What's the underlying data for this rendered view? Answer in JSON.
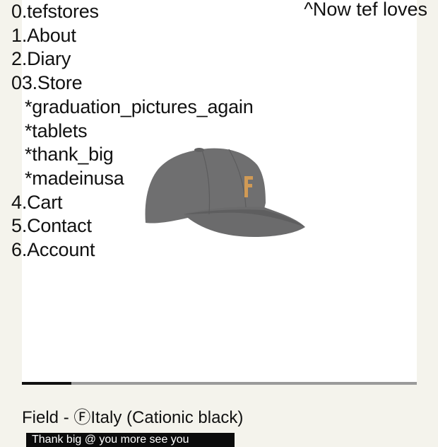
{
  "colors": {
    "page_background": "#f4f3ec",
    "panel_background": "#ffffff",
    "text": "#111111",
    "progress_track": "#9a9a9a",
    "progress_fill": "#111111",
    "cap_body": "#6f6f70",
    "cap_letter": "#d09a55"
  },
  "nav": {
    "items": [
      {
        "label": "0.tefstores"
      },
      {
        "label": "1.About"
      },
      {
        "label": "2.Diary"
      },
      {
        "label": "03.Store"
      },
      {
        "label": "*graduation_pictures_again"
      },
      {
        "label": "*tablets"
      },
      {
        "label": "*thank_big"
      },
      {
        "label": "*madeinusa"
      },
      {
        "label": "4.Cart"
      },
      {
        "label": "5.Contact"
      },
      {
        "label": "6.Account"
      }
    ]
  },
  "header": {
    "now_link": "^Now tef loves"
  },
  "product": {
    "image_icon": "baseball-cap-with-f-logo",
    "gallery_progress": 0.125,
    "title": "Field - ⒻItaly (Cationic black)"
  },
  "announcement": {
    "text": "Thank big  @ you more see you"
  }
}
